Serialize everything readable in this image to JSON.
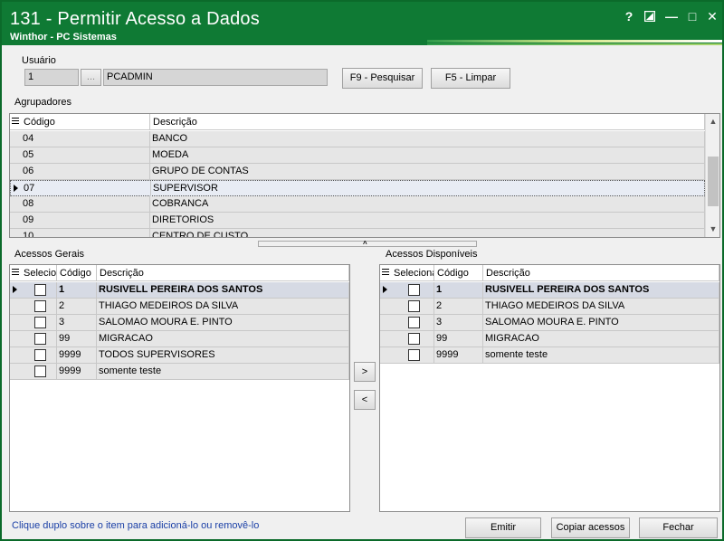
{
  "window": {
    "title": "131 - Permitir Acesso a Dados",
    "subtitle": "Winthor - PC Sistemas",
    "controls": {
      "help": "?",
      "restore": "■",
      "minimize": "—",
      "maximize": "□",
      "close": "✕"
    }
  },
  "usuario": {
    "label": "Usuário",
    "code": "1",
    "lookup_label": "...",
    "name": "PCADMIN",
    "search_button": "F9 - Pesquisar",
    "clear_button": "F5 - Limpar"
  },
  "agrupadores": {
    "label": "Agrupadores",
    "columns": [
      "Código",
      "Descrição"
    ],
    "rows": [
      {
        "code": "04",
        "desc": "BANCO"
      },
      {
        "code": "05",
        "desc": "MOEDA"
      },
      {
        "code": "06",
        "desc": "GRUPO DE CONTAS"
      },
      {
        "code": "07",
        "desc": "SUPERVISOR"
      },
      {
        "code": "08",
        "desc": "COBRANCA"
      },
      {
        "code": "09",
        "desc": "DIRETORIOS"
      },
      {
        "code": "10",
        "desc": "CENTRO DE CUSTO"
      }
    ]
  },
  "acessos_gerais": {
    "label": "Acessos Gerais",
    "columns": [
      "Selecionar",
      "Código",
      "Descrição"
    ],
    "rows": [
      {
        "code": "1",
        "desc": "RUSIVELL PEREIRA DOS SANTOS"
      },
      {
        "code": "2",
        "desc": "THIAGO MEDEIROS DA SILVA"
      },
      {
        "code": "3",
        "desc": "SALOMAO MOURA E. PINTO"
      },
      {
        "code": "99",
        "desc": "MIGRACAO"
      },
      {
        "code": "9999",
        "desc": "TODOS SUPERVISORES"
      },
      {
        "code": "9999",
        "desc": "somente teste"
      }
    ]
  },
  "acessos_disponiveis": {
    "label": "Acessos Disponíveis",
    "columns": [
      "Selecionar",
      "Código",
      "Descrição"
    ],
    "rows": [
      {
        "code": "1",
        "desc": "RUSIVELL PEREIRA DOS SANTOS"
      },
      {
        "code": "2",
        "desc": "THIAGO MEDEIROS DA SILVA"
      },
      {
        "code": "3",
        "desc": "SALOMAO MOURA E. PINTO"
      },
      {
        "code": "99",
        "desc": "MIGRACAO"
      },
      {
        "code": "9999",
        "desc": "somente teste"
      }
    ]
  },
  "transfer": {
    "add": ">",
    "remove": "<"
  },
  "footer": {
    "hint": "Clique duplo sobre o item para adicioná-lo ou removê-lo",
    "emitir": "Emitir",
    "copiar": "Copiar acessos",
    "fechar": "Fechar"
  },
  "colors": {
    "titlebar": "#0f7a34",
    "hint_text": "#1a3fa6"
  }
}
